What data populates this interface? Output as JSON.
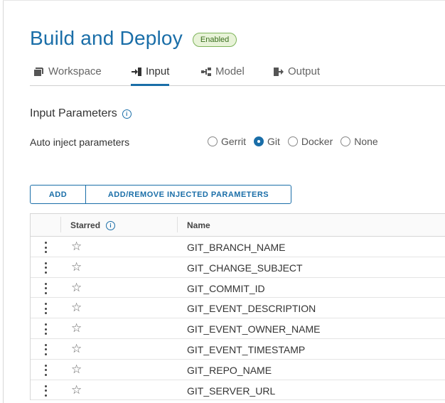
{
  "header": {
    "title": "Build and Deploy",
    "status_badge": "Enabled"
  },
  "tabs": [
    {
      "label": "Workspace",
      "icon": "workspace-icon",
      "active": false
    },
    {
      "label": "Input",
      "icon": "input-icon",
      "active": true
    },
    {
      "label": "Model",
      "icon": "model-icon",
      "active": false
    },
    {
      "label": "Output",
      "icon": "output-icon",
      "active": false
    }
  ],
  "section": {
    "title": "Input Parameters",
    "info_icon": "info-icon"
  },
  "auto_inject": {
    "label": "Auto inject parameters",
    "options": [
      "Gerrit",
      "Git",
      "Docker",
      "None"
    ],
    "selected": "Git"
  },
  "buttons": {
    "add": "ADD",
    "inject": "ADD/REMOVE INJECTED PARAMETERS"
  },
  "table": {
    "columns": {
      "starred": "Starred",
      "name": "Name"
    },
    "rows": [
      "GIT_BRANCH_NAME",
      "GIT_CHANGE_SUBJECT",
      "GIT_COMMIT_ID",
      "GIT_EVENT_DESCRIPTION",
      "GIT_EVENT_OWNER_NAME",
      "GIT_EVENT_TIMESTAMP",
      "GIT_REPO_NAME",
      "GIT_SERVER_URL"
    ]
  },
  "colors": {
    "accent": "#1a6ea8",
    "badge_bg": "#e8f3d8",
    "badge_border": "#7db35a"
  }
}
